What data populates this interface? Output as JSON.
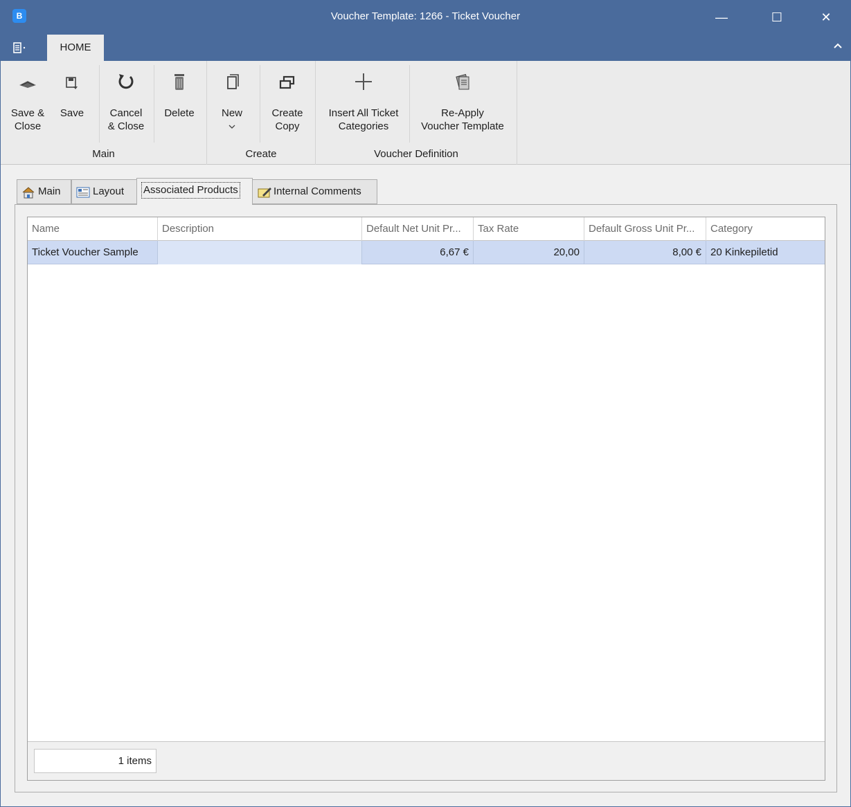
{
  "window": {
    "app_icon_letter": "B",
    "title": "Voucher Template: 1266 - Ticket Voucher",
    "minimize_glyph": "—",
    "maximize_glyph": "☐",
    "close_glyph": "✕"
  },
  "ribbon": {
    "file_menu_icon": "menu-icon",
    "tab_home": "HOME",
    "collapse_icon": "chevron-up-icon",
    "groups": {
      "main": "Main",
      "create": "Create",
      "voucher_definition": "Voucher Definition"
    },
    "buttons": {
      "save_close_line1": "Save &",
      "save_close_line2": "Close",
      "save": "Save",
      "cancel_close_line1": "Cancel",
      "cancel_close_line2": "& Close",
      "delete": "Delete",
      "new": "New",
      "create_copy_line1": "Create",
      "create_copy_line2": "Copy",
      "insert_line1": "Insert All Ticket",
      "insert_line2": "Categories",
      "reapply_line1": "Re-Apply",
      "reapply_line2": "Voucher Template"
    }
  },
  "tabs": {
    "main": "Main",
    "layout": "Layout",
    "associated_products": "Associated Products",
    "internal_comments": "Internal Comments"
  },
  "grid": {
    "columns": [
      "Name",
      "Description",
      "Default Net Unit Pr...",
      "Tax Rate",
      "Default Gross Unit Pr...",
      "Category"
    ],
    "rows": [
      {
        "name": "Ticket Voucher Sample",
        "description": "",
        "net_price": "6,67 €",
        "tax_rate": "20,00",
        "gross_price": "8,00 €",
        "category": "20 Kinkepiletid"
      }
    ],
    "item_count": "1 items"
  },
  "colors": {
    "title_bar": "#4a6b9c",
    "selected_row": "#cddaf3"
  }
}
